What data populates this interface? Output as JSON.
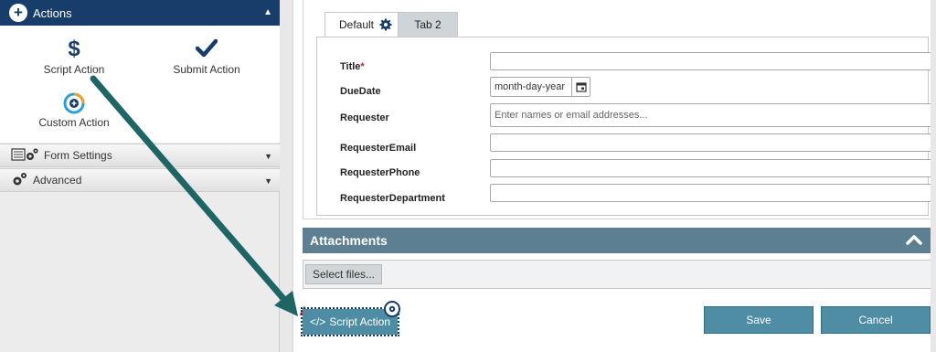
{
  "sidebar": {
    "header": {
      "title": "Actions"
    },
    "actions": [
      {
        "label": "Script Action",
        "icon": "dollar-icon"
      },
      {
        "label": "Submit Action",
        "icon": "checkmark-icon"
      },
      {
        "label": "Custom Action",
        "icon": "custom-action-icon"
      }
    ],
    "sections": [
      {
        "label": "Form Settings",
        "icon": "form-settings-icon"
      },
      {
        "label": "Advanced",
        "icon": "gears-icon"
      }
    ]
  },
  "tabs": [
    {
      "label": "Default",
      "active": true
    },
    {
      "label": "Tab 2",
      "active": false
    }
  ],
  "form": {
    "fields": [
      {
        "label": "Title",
        "required": true,
        "value": "",
        "placeholder": ""
      },
      {
        "label": "DueDate",
        "value": "month-day-year"
      },
      {
        "label": "Requester",
        "placeholder": "Enter names or email addresses..."
      },
      {
        "label": "RequesterEmail",
        "value": ""
      },
      {
        "label": "RequesterPhone",
        "value": ""
      },
      {
        "label": "RequesterDepartment",
        "value": ""
      }
    ],
    "required_marker": "*"
  },
  "attachments": {
    "title": "Attachments",
    "select_label": "Select files..."
  },
  "buttons": {
    "save": "Save",
    "cancel": "Cancel"
  },
  "dropped_control": {
    "label": "Script Action",
    "code_glyph": "</>"
  },
  "colors": {
    "header_navy": "#173d6b",
    "teal_button": "#4e8da3",
    "attach_bar": "#5c7f91",
    "arrow_teal": "#1e6566",
    "required_red": "#c0202a",
    "warning_red": "#d32f2f"
  }
}
